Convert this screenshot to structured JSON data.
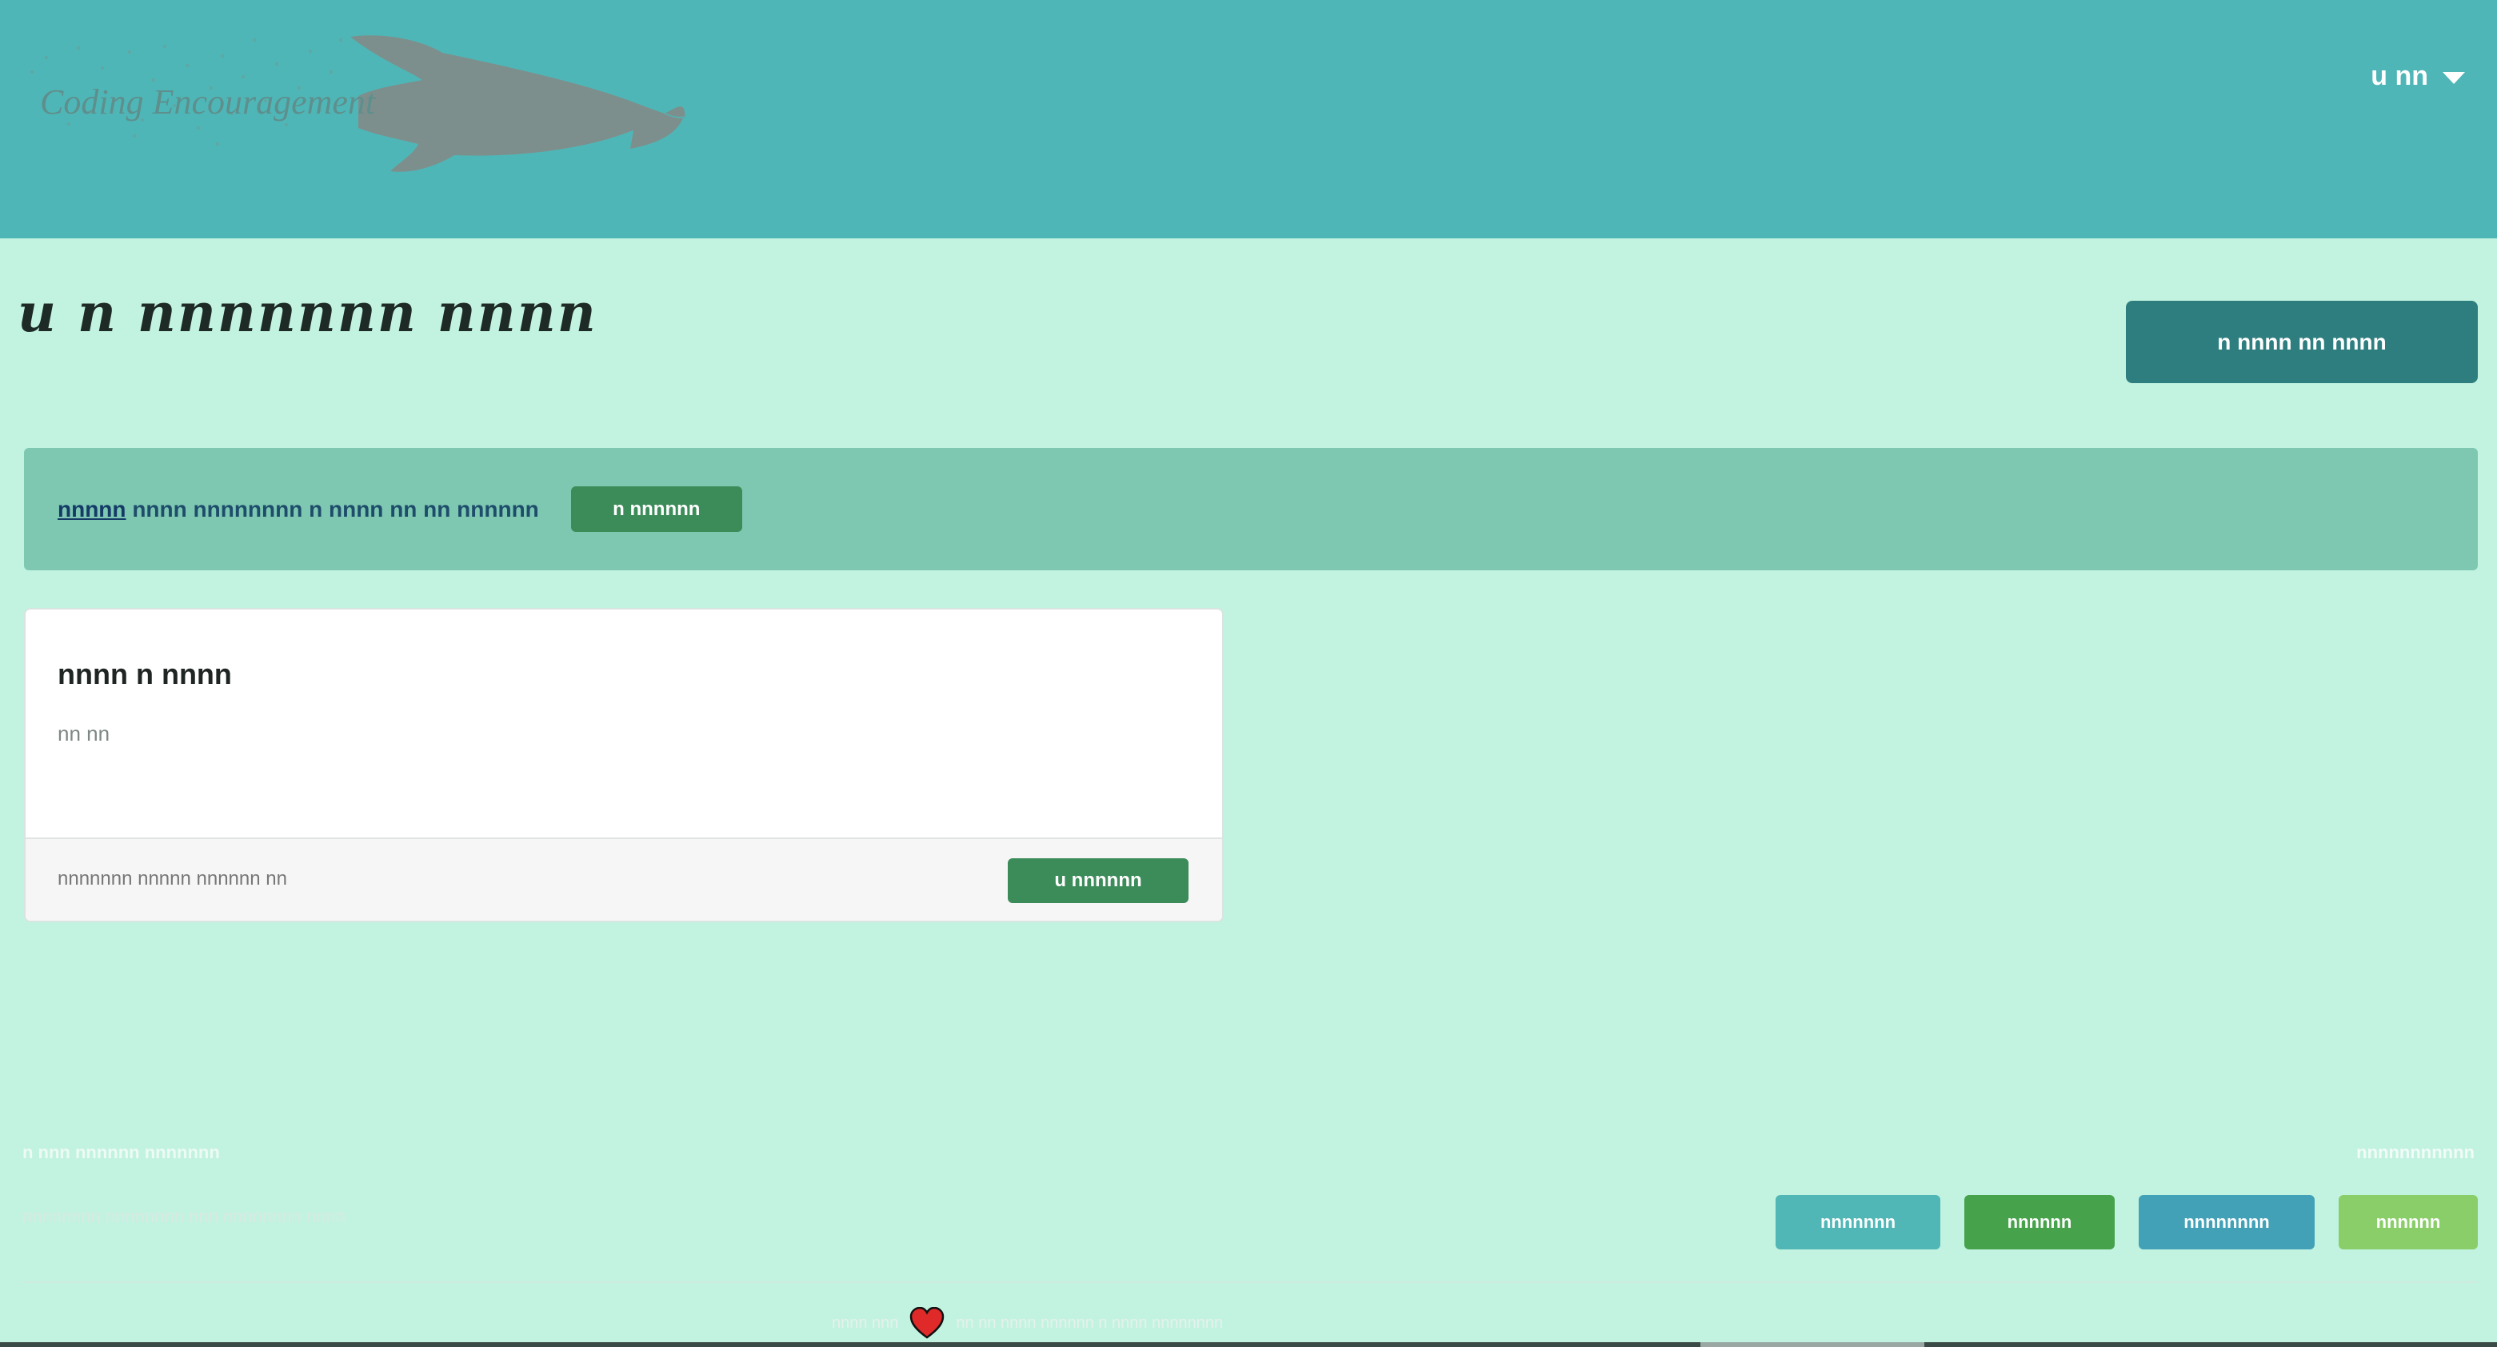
{
  "header": {
    "logo_text": "Coding Encouragement",
    "user_menu_label": "u nn"
  },
  "page": {
    "title": "u n nnnnnnn nnnn",
    "primary_action_label": "n nnnn nn nnnn"
  },
  "alert": {
    "strong_text": "nnnnn",
    "text": "nnnn nnnnnnnn n nnnn nn nn nnnnnn",
    "button_label": "n nnnnnn"
  },
  "card": {
    "title": "nnnn n nnnn",
    "subtitle": "nn nn",
    "meta": "nnnnnnn nnnnn nnnnnn nn",
    "button_label": "u nnnnnn"
  },
  "footer": {
    "tagline": "n nnn nnnnnn nnnnnnn",
    "copyright": "nnnnnnnn nnnnnnnn nnn nnnnnnnn nnnn",
    "right_link": "nnnnnnnnnnn",
    "theme_buttons": [
      {
        "label": "nnnnnnn",
        "color": "#50b6b6"
      },
      {
        "label": "nnnnnn",
        "color": "#46a24b"
      },
      {
        "label": "nnnnnnnn",
        "color": "#42a1b7"
      },
      {
        "label": "nnnnnn",
        "color": "#8ace6a"
      }
    ],
    "credit_left": "nnnn nnn",
    "credit_right": "nn nn nnnn nnnnnn n nnnn nnnnnnnn"
  },
  "icons": {
    "logo": "rocket-icon",
    "user_menu_caret": "caret-down-icon",
    "credit_heart": "heart-icon"
  },
  "colors": {
    "header_bg": "#4fb6b7",
    "page_bg": "#c2f3e0",
    "primary_action": "#2e7e7f",
    "alert_bg": "#7ec8b2",
    "success_button": "#3c8c5a"
  }
}
